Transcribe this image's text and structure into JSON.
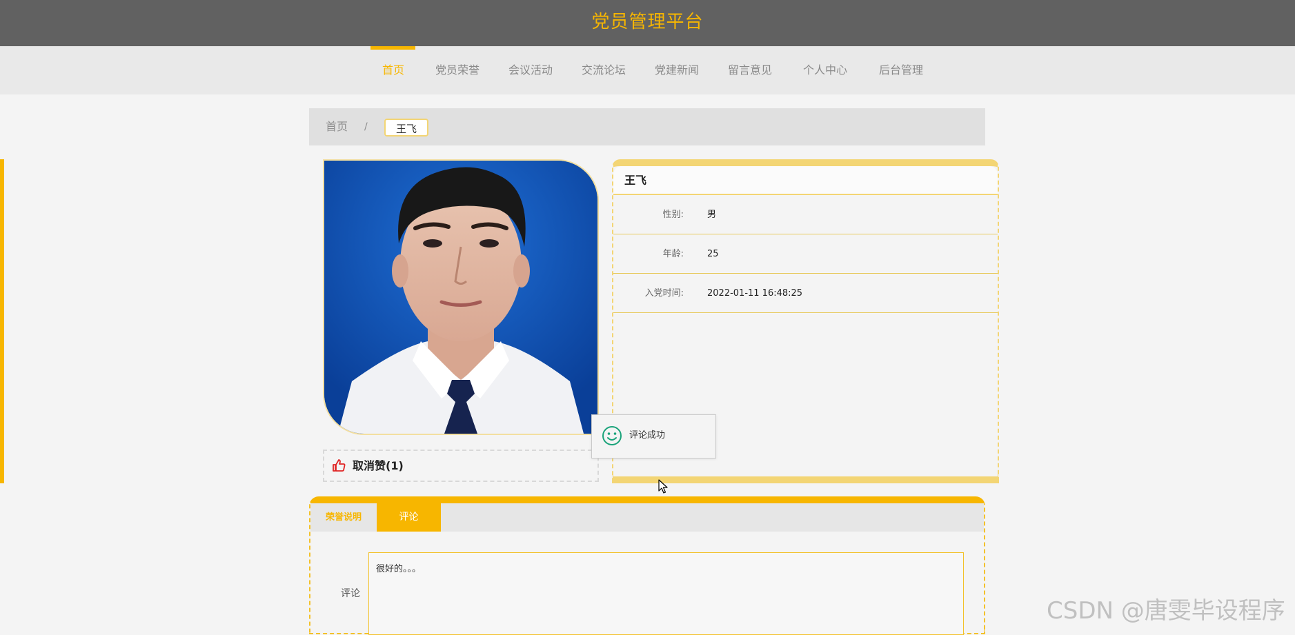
{
  "header": {
    "title": "党员管理平台",
    "accent_color": "#f7b600"
  },
  "nav": {
    "items": [
      {
        "label": "首页",
        "active": true
      },
      {
        "label": "党员荣誉",
        "active": false
      },
      {
        "label": "会议活动",
        "active": false
      },
      {
        "label": "交流论坛",
        "active": false
      },
      {
        "label": "党建新闻",
        "active": false
      },
      {
        "label": "留言意见",
        "active": false
      },
      {
        "label": "个人中心",
        "active": false
      },
      {
        "label": "后台管理",
        "active": false
      }
    ]
  },
  "breadcrumb": {
    "home": "首页",
    "separator": "/",
    "current": "王飞"
  },
  "profile": {
    "name": "王飞",
    "fields": [
      {
        "label": "性别:",
        "value": "男"
      },
      {
        "label": "年龄:",
        "value": "25"
      },
      {
        "label": "入党时间:",
        "value": "2022-01-11 16:48:25"
      }
    ]
  },
  "like": {
    "label": "取消赞(1)",
    "icon": "thumbs-up-icon"
  },
  "toast": {
    "text": "评论成功",
    "icon": "smile-icon"
  },
  "tabs": [
    {
      "label": "荣誉说明",
      "active": false
    },
    {
      "label": "评论",
      "active": true
    }
  ],
  "comment": {
    "label": "评论",
    "value": "很好的。。。"
  },
  "watermark": "CSDN @唐雯毕设程序"
}
